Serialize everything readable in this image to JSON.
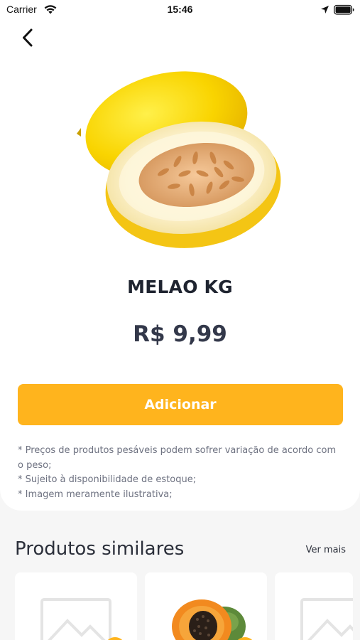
{
  "status_bar": {
    "carrier": "Carrier",
    "time": "15:46"
  },
  "product": {
    "name": "MELAO KG",
    "price": "R$ 9,99",
    "add_label": "Adicionar",
    "image_icon": "melon-image"
  },
  "disclaimer": [
    "* Preços de produtos pesáveis podem sofrer variação de acordo com o peso;",
    "* Sujeito à disponibilidade de estoque;",
    "* Imagem meramente ilustrativa;"
  ],
  "similar": {
    "title": "Produtos similares",
    "see_more": "Ver mais",
    "items": [
      {
        "image": "placeholder-image-icon"
      },
      {
        "image": "papaya-image"
      },
      {
        "image": "placeholder-image-icon"
      }
    ]
  },
  "colors": {
    "accent": "#ffb41d",
    "background": "#f6f6f6",
    "card": "#ffffff",
    "text_dark": "#2b2f3a",
    "text_muted": "#6d7180"
  }
}
